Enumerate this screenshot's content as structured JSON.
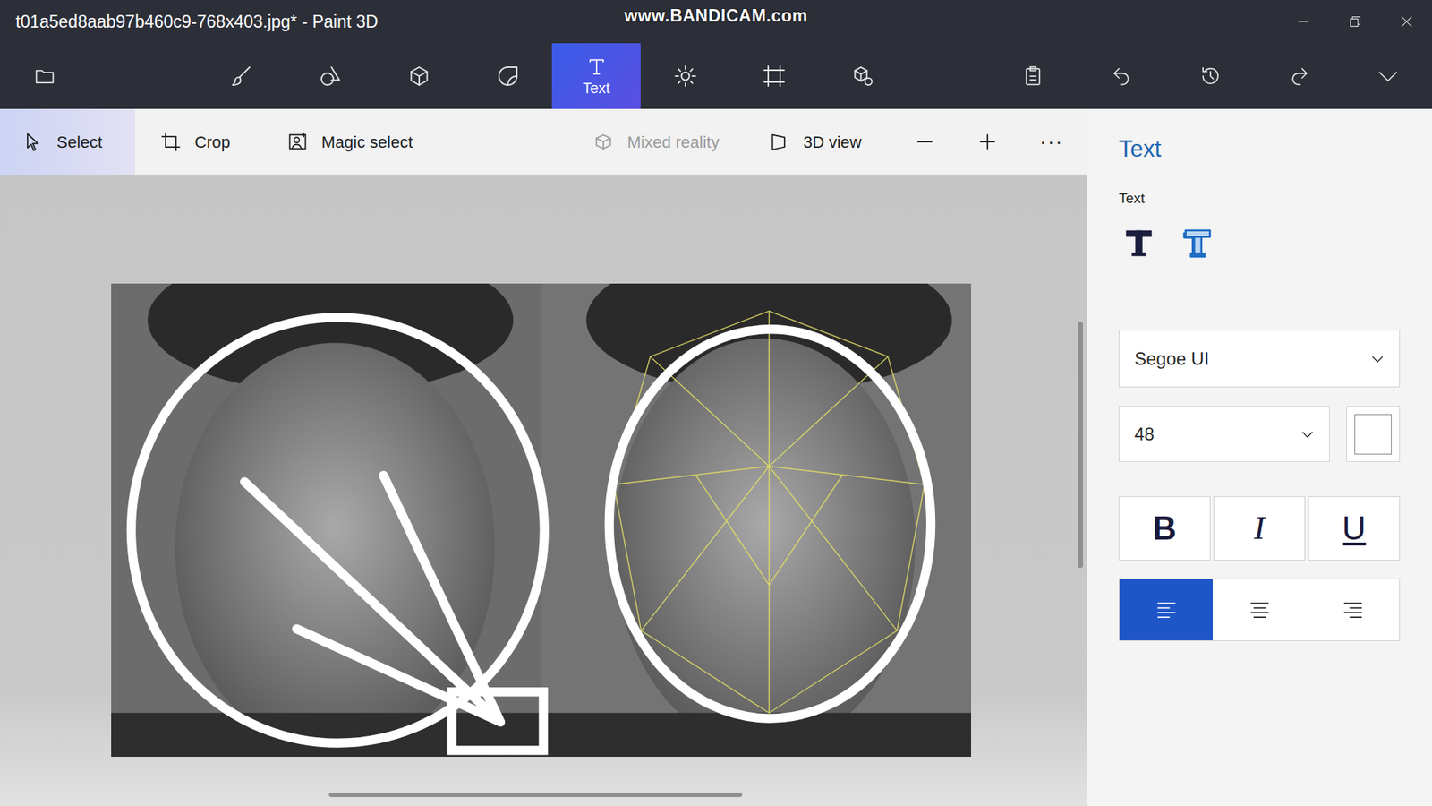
{
  "window": {
    "title": "t01a5ed8aab97b460c9-768x403.jpg* - Paint 3D",
    "watermark": "www.BANDICAM.com"
  },
  "toolbar": {
    "menu": {
      "kind": "menu"
    },
    "tools": [
      {
        "kind": "brushes",
        "selected": false
      },
      {
        "kind": "shapes2d",
        "selected": false
      },
      {
        "kind": "shapes3d",
        "selected": false
      },
      {
        "kind": "stickers",
        "selected": false
      },
      {
        "kind": "text",
        "label": "Text",
        "selected": true
      },
      {
        "kind": "effects",
        "selected": false
      },
      {
        "kind": "canvas",
        "selected": false
      },
      {
        "kind": "library3d",
        "selected": false
      }
    ],
    "actions": [
      {
        "kind": "paste"
      },
      {
        "kind": "undo"
      },
      {
        "kind": "history"
      },
      {
        "kind": "redo"
      },
      {
        "kind": "expand"
      }
    ]
  },
  "subtoolbar": [
    {
      "kind": "select",
      "label": "Select",
      "selected": true,
      "disabled": false
    },
    {
      "kind": "crop",
      "label": "Crop",
      "selected": false,
      "disabled": false
    },
    {
      "kind": "magic",
      "label": "Magic select",
      "selected": false,
      "disabled": false
    },
    {
      "kind": "mixed",
      "label": "Mixed reality",
      "selected": false,
      "disabled": true
    },
    {
      "kind": "view3d",
      "label": "3D view",
      "selected": false,
      "disabled": false
    },
    {
      "kind": "minus",
      "selected": false,
      "disabled": false
    },
    {
      "kind": "plus",
      "selected": false,
      "disabled": false
    },
    {
      "kind": "more",
      "label": "···",
      "selected": false,
      "disabled": false
    }
  ],
  "scrollbars": {
    "vertical": {
      "level": 0.39
    },
    "horizontal": {
      "level": 0.38
    }
  },
  "panel": {
    "title": "Text",
    "section": "Text",
    "text_types": [
      {
        "kind": "text2d",
        "selected": false
      },
      {
        "kind": "text3d",
        "selected": false
      }
    ],
    "font": "Segoe UI",
    "size": "48",
    "color": "#ffffff",
    "styles": [
      {
        "kind": "bold",
        "label": "B",
        "on": false
      },
      {
        "kind": "italic",
        "label": "I",
        "on": false
      },
      {
        "kind": "underline",
        "label": "U",
        "on": false
      }
    ],
    "align": [
      {
        "kind": "left",
        "selected": true
      },
      {
        "kind": "center",
        "selected": false
      },
      {
        "kind": "right",
        "selected": false
      }
    ]
  }
}
